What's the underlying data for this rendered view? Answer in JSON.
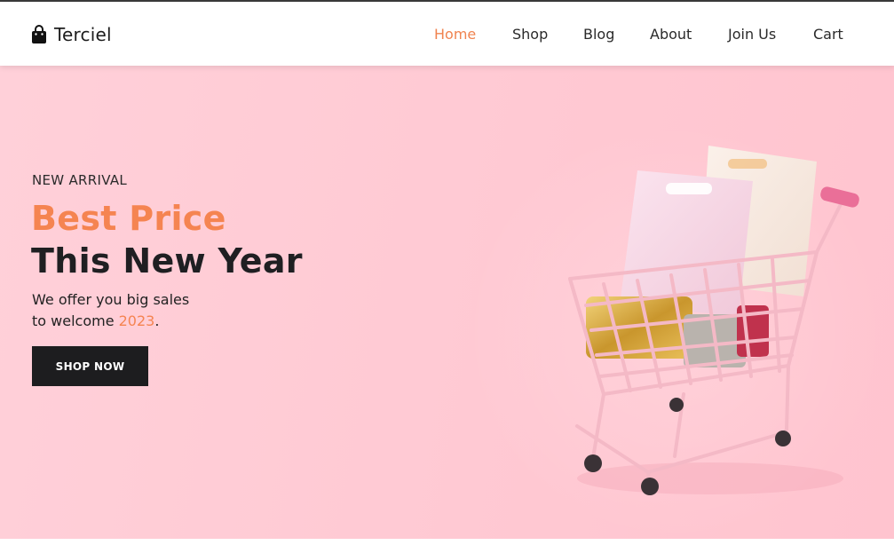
{
  "brand": {
    "name": "Terciel",
    "icon": "shopping-bag-icon"
  },
  "nav": {
    "items": [
      {
        "label": "Home",
        "active": true
      },
      {
        "label": "Shop",
        "active": false
      },
      {
        "label": "Blog",
        "active": false
      },
      {
        "label": "About",
        "active": false
      },
      {
        "label": "Join Us",
        "active": false
      },
      {
        "label": "Cart",
        "active": false
      }
    ]
  },
  "hero": {
    "eyebrow": "NEW ARRIVAL",
    "headline_line1": "Best Price",
    "headline_line2": "This New Year",
    "subtext_line1": "We offer you big sales",
    "subtext_line2_prefix": "to welcome ",
    "subtext_year": "2023",
    "subtext_line2_suffix": ".",
    "cta_label": "SHOP NOW",
    "image": "shopping-cart-with-bags"
  },
  "colors": {
    "accent": "#f58451",
    "hero_background": "#ffc9d3",
    "button_background": "#1d1d1f",
    "text_dark": "#1f1f22"
  }
}
